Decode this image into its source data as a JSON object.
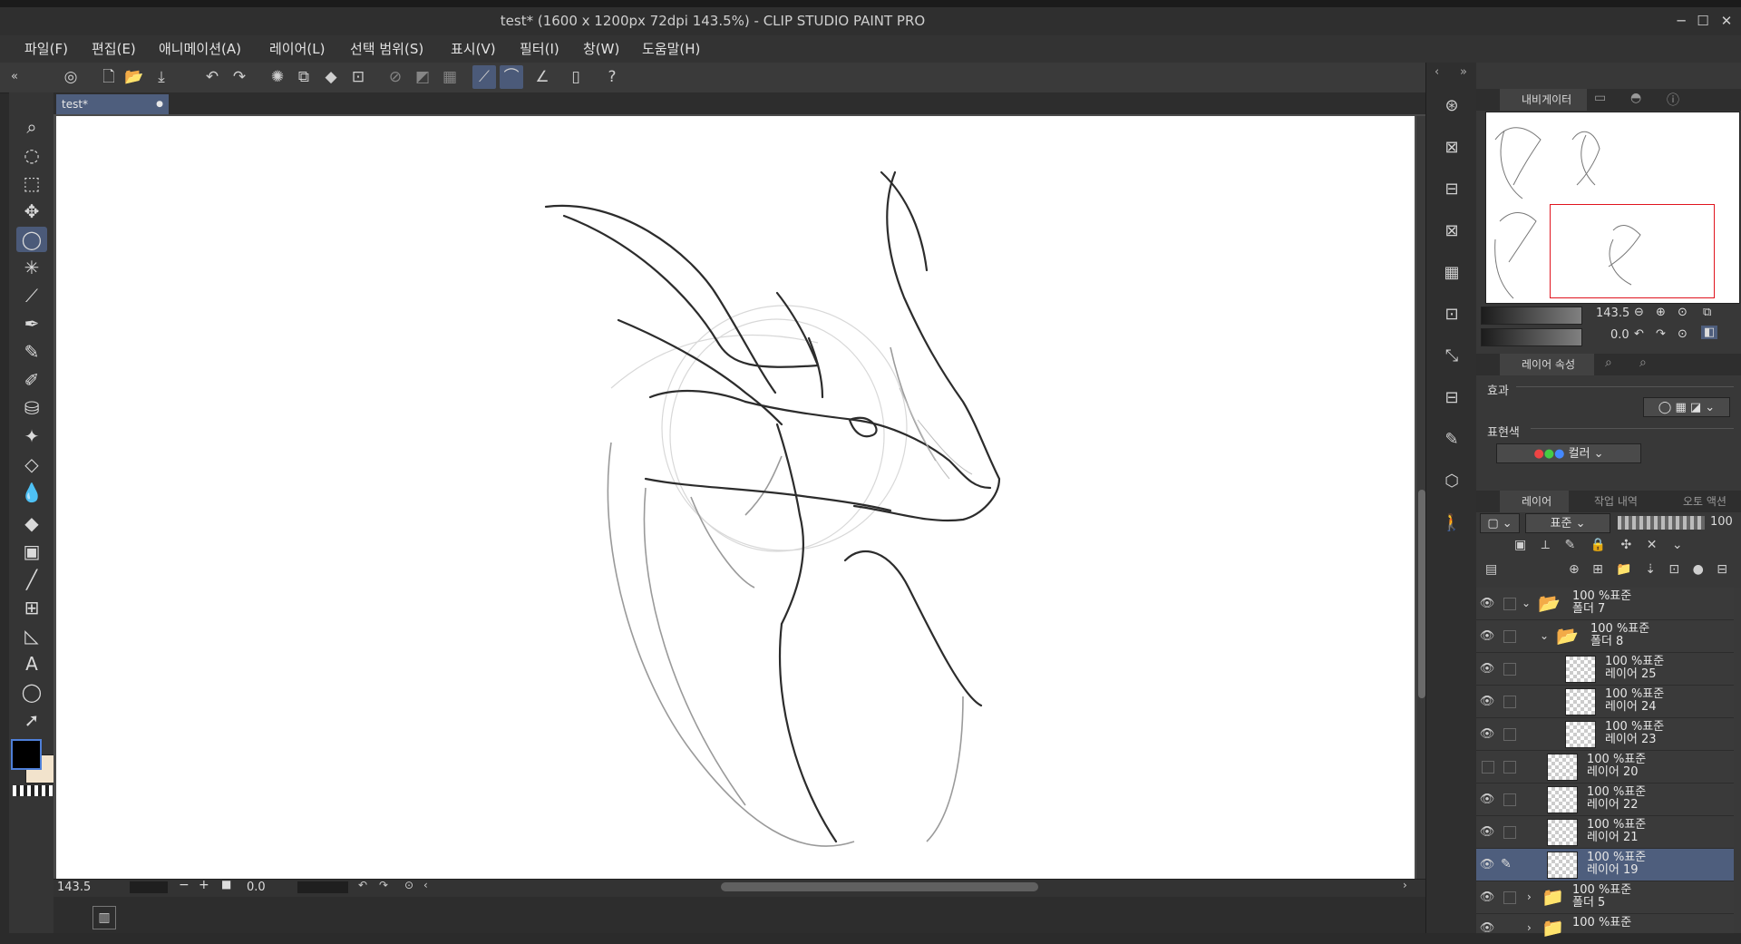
{
  "window": {
    "title": "test* (1600 x 1200px 72dpi 143.5%)  - CLIP STUDIO PAINT PRO"
  },
  "menu": [
    "파일(F)",
    "편집(E)",
    "애니메이션(A)",
    "레이어(L)",
    "선택 범위(S)",
    "표시(V)",
    "필터(I)",
    "창(W)",
    "도움말(H)"
  ],
  "document": {
    "tab": "test*"
  },
  "status": {
    "zoom": "143.5",
    "angle": "0.0"
  },
  "navigator": {
    "tab": "내비게이터",
    "zoom": "143.5",
    "rotation": "0.0"
  },
  "layer_property": {
    "tab": "레이어 속성",
    "effect_label": "효과",
    "expression_label": "표현색",
    "expression_value": "컬러"
  },
  "layers_panel": {
    "tabs": [
      "레이어",
      "작업 내역",
      "오토 액션"
    ],
    "blend_mode": "표준",
    "opacity": "100",
    "rows": [
      {
        "meta": "100 %표준",
        "name": "폴더 7"
      },
      {
        "meta": "100 %표준",
        "name": "폴더 8"
      },
      {
        "meta": "100 %표준",
        "name": "레이어 25"
      },
      {
        "meta": "100 %표준",
        "name": "레이어 24"
      },
      {
        "meta": "100 %표준",
        "name": "레이어 23"
      },
      {
        "meta": "100 %표준",
        "name": "레이어 20"
      },
      {
        "meta": "100 %표준",
        "name": "레이어 22"
      },
      {
        "meta": "100 %표준",
        "name": "레이어 21"
      },
      {
        "meta": "100 %표준",
        "name": "레이어 19"
      },
      {
        "meta": "100 %표준",
        "name": "폴더 5"
      },
      {
        "meta": "100 %표준",
        "name": ""
      }
    ]
  },
  "colors": {
    "main": "#000000",
    "sub": "#f2e3cc",
    "accent": "#4e5e7d",
    "nav_frame": "#e0141e"
  }
}
